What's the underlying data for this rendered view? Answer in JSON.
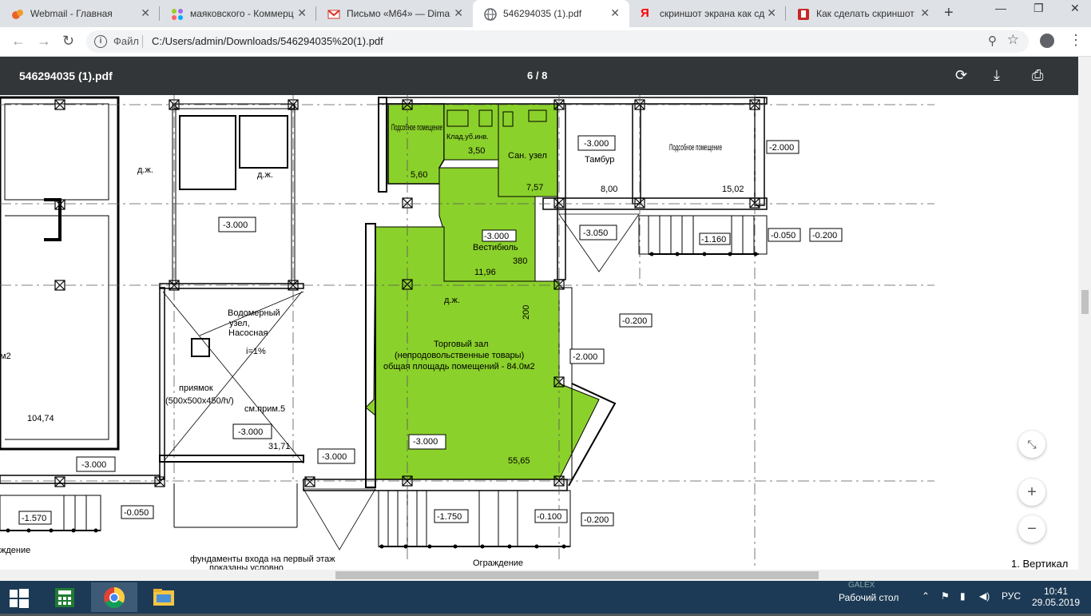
{
  "tabs": [
    {
      "title": "Webmail - Главная"
    },
    {
      "title": "маяковского - Коммерц"
    },
    {
      "title": "Письмо «М64» — Dima"
    },
    {
      "title": "546294035 (1).pdf"
    },
    {
      "title": "скриншот экрана как сд"
    },
    {
      "title": "Как сделать скриншот"
    }
  ],
  "address": {
    "scheme": "Файл",
    "url": "C:/Users/admin/Downloads/546294035%20(1).pdf"
  },
  "pdf": {
    "filename": "546294035 (1).pdf",
    "page_indicator": "6 / 8"
  },
  "plan": {
    "room_podsobnoe_1": "Подсобное помещение",
    "room_podsobnoe_1_area": "5,60",
    "room_klad": "Клад.уб.инв.",
    "room_klad_area": "3,50",
    "room_sanuzel": "Сан. узел",
    "room_sanuzel_area": "7,57",
    "room_tambur": "Тамбур",
    "room_tambur_area": "8,00",
    "room_podsobnoe_2": "Подсобное помещение",
    "room_podsobnoe_2_area": "15,02",
    "room_vestibul": "Вестибюль",
    "room_vestibul_area": "11,96",
    "room_zal_1": "Торговый зал",
    "room_zal_2": "(непродовольственные товары)",
    "room_zal_3": "общая площадь помещений - 84.0м2",
    "room_zal_area": "55,65",
    "room_vodomer_1": "Водомерный",
    "room_vodomer_2": "узел,",
    "room_vodomer_3": "Насосная",
    "slope": "i=1%",
    "priyamok": "приямок",
    "priyamok_size": "(500x500x450/h/)",
    "sm_prim": "см.прим.5",
    "vodomer_area": "31,71",
    "left_area": "104,74",
    "dzh_1": "д.ж.",
    "dzh_2": "д.ж.",
    "dzh_3": "д.ж.",
    "dim_380": "380",
    "dim_200": "200",
    "level_m3000": "-3.000",
    "level_m3050": "-3.050",
    "level_m2000": "-2.000",
    "level_m1160": "-1.160",
    "level_m0050": "-0.050",
    "level_m0200": "-0.200",
    "level_m1570": "-1.570",
    "level_m1750": "-1.750",
    "level_m0100": "-0.100",
    "fundament_1": "фундаменты входа на первый этаж",
    "fundament_2": "показаны условно",
    "ograzhdenie": "Ограждение",
    "ograzhdenie_left": "ждение",
    "note": "1. Вертикал",
    "frag_m2": "м2"
  },
  "taskbar": {
    "desktop_label": "Рабочий стол",
    "lang": "РУС",
    "time": "10:41",
    "date": "29.05.2019",
    "brand": "GALEX"
  }
}
